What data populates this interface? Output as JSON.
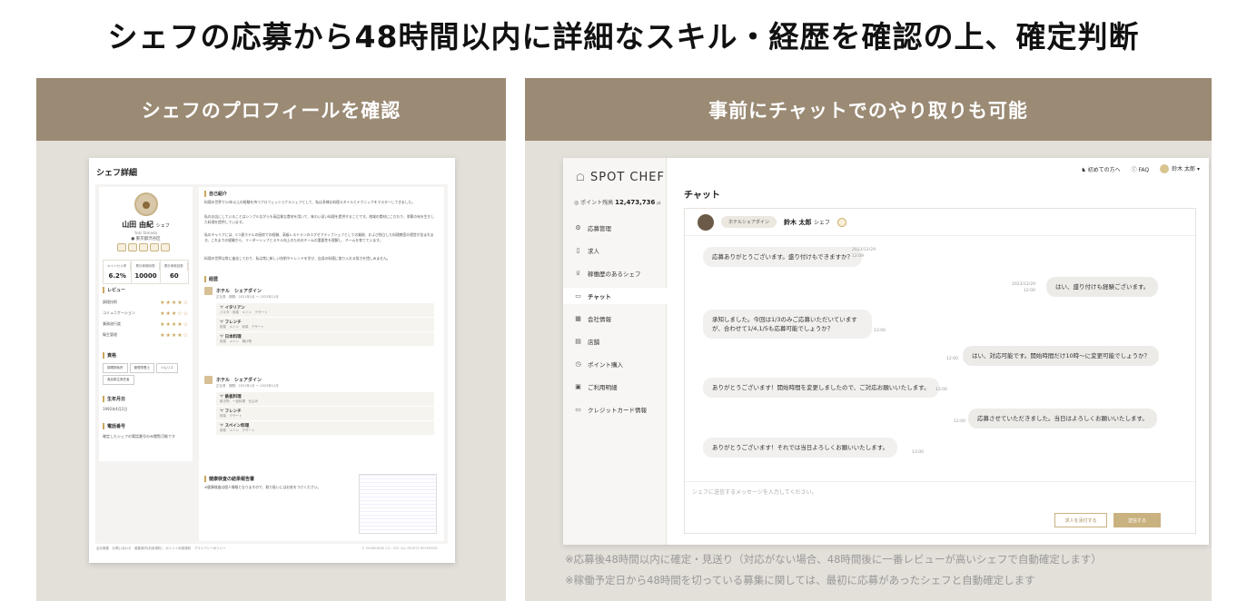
{
  "headline": "シェフの応募から48時間以内に詳細なスキル・経歴を確認の上、確定判断",
  "left_panel": {
    "heading": "シェフのプロフィールを確認",
    "profile": {
      "title": "シェフ詳細",
      "name": "山田 由紀",
      "name_suffix": "シェフ",
      "romaji": "Yuki Yamada",
      "location": "東京都渋谷区",
      "stats": [
        {
          "label": "キャンセル率",
          "value": "6.2%"
        },
        {
          "label": "累計稼働時間",
          "value": "10000"
        },
        {
          "label": "累計稼働回数",
          "value": "60"
        }
      ],
      "review_heading": "レビュー",
      "reviews": [
        {
          "label": "調理技術",
          "stars": "★★★★☆"
        },
        {
          "label": "コミュニケーション",
          "stars": "★★★☆☆"
        },
        {
          "label": "業務遂行度",
          "stars": "★★★★☆"
        },
        {
          "label": "衛生管理",
          "stars": "★★★★☆"
        }
      ],
      "qual_heading": "資格",
      "quals": [
        "調理師免許",
        "管理栄養士",
        "ソムリエ",
        "食品衛生責任者"
      ],
      "birth_heading": "生年月日",
      "birth": "1992年4月2日",
      "phone_heading": "電話番号",
      "phone": "確定したシェフの電話番号のみ閲覧可能です",
      "intro_heading": "自己紹介",
      "intro_1": "料理の世界で10年以上の経験を持つプロフェッショナルシェフとして、私は多様な料理スタイルとテクニックをマスターしてきました。",
      "intro_2": "私のお店にしていることはシンプルながらも高品質な食材を用いて、味わい深い料理を提供することです。地域の食材にこだわり、季節の旬を生かした料理を提供しています。",
      "intro_3": "私のキャリアには、5つ星ホテルの厨房での経験、高級レストランのエグゼクティブシェフとしての業務、および独立した料理教室の運営が含まれます。これまでの経験から、リーダーシップとスキル向上のためのチームの重要性を理解し、チームを育てています。",
      "intro_4": "料理の世界は常に進化しており、私は常に新しい技術やトレンドを学び、自身の料理に取り入れる努力を惜しみません。",
      "career_heading": "経歴",
      "jobs": [
        {
          "place": "ホテル　シェアダイン",
          "period": "正社員　期間：2021年1月 〜 2023年12月",
          "items": [
            {
              "name": "イタリアン",
              "detail": "パスタ・前菜　メイン　デザート"
            },
            {
              "name": "フレンチ",
              "detail": "前菜　メイン　前菜　デザート"
            },
            {
              "name": "日本料理",
              "detail": "前菜　メイン　揚げ物"
            }
          ]
        },
        {
          "place": "ホテル　シェアダイン",
          "period": "正社員　期間：2021年1月 〜 2023年12月",
          "items": [
            {
              "name": "鉄板料理",
              "detail": "焼き物　一品料理　仕込み"
            },
            {
              "name": "フレンチ",
              "detail": "前菜　デザート"
            },
            {
              "name": "スペイン料理",
              "detail": "前菜　メイン　デザート"
            }
          ]
        }
      ],
      "health_heading": "健康検査の結果報告書",
      "health_text": "※健康検査は個人情報となりますので、取り扱いにはお気をつけください。",
      "footer_links": "会社概要　お問い合わせ　募集案内(利用規約)　ポイント利用規約　プライバシーポリシー",
      "footer_copy": "© SHAREDINE CO., LTD. ALL RIGHTS RESERVED."
    }
  },
  "right_panel": {
    "heading": "事前にチャットでのやり取りも可能",
    "app": {
      "logo": "SPOT CHEF",
      "points_label": "ポイント残高",
      "points_value": "12,473,736",
      "points_unit": "pt",
      "nav": [
        {
          "icon": "⚙",
          "label": "応募管理",
          "active": false
        },
        {
          "icon": "▯",
          "label": "求人",
          "active": false
        },
        {
          "icon": "♕",
          "label": "稼働歴のあるシェフ",
          "active": false
        },
        {
          "icon": "▭",
          "label": "チャット",
          "active": true
        },
        {
          "icon": "▦",
          "label": "会社情報",
          "active": false
        },
        {
          "icon": "▤",
          "label": "店舗",
          "active": false
        },
        {
          "icon": "◷",
          "label": "ポイント購入",
          "active": false
        },
        {
          "icon": "▣",
          "label": "ご利用明細",
          "active": false
        },
        {
          "icon": "▭",
          "label": "クレジットカード情報",
          "active": false
        }
      ],
      "topbar": {
        "beginner": "初めての方へ",
        "faq": "FAQ",
        "user": "鈴木 太郎"
      },
      "page_title": "チャット",
      "chat_tag": "ホテルシェアダイン",
      "chat_name": "鈴木 太郎",
      "chat_name_suffix": "シェフ",
      "messages": [
        {
          "side": "l",
          "text": "応募ありがとうございます。盛り付けもできますか？",
          "date": "2023/12/29",
          "time": "12:09"
        },
        {
          "side": "r",
          "text": "はい、盛り付けも経験ございます。",
          "date": "2023/12/29",
          "time": "12:00"
        },
        {
          "side": "l",
          "text": "承知しました。今回は1/3のみご応募いただいていますが、合わせて1/4,1/5も応募可能でしょうか？",
          "date": "",
          "time": "13:00"
        },
        {
          "side": "r",
          "text": "はい、対応可能です。開始時間だけ10時〜に変更可能でしょうか？",
          "date": "",
          "time": "12:00"
        },
        {
          "side": "l",
          "text": "ありがとうございます！開始時間を変更しましたので、ご対応お願いいたします。",
          "date": "",
          "time": "13:00"
        },
        {
          "side": "r",
          "text": "応募させていただきました。当日はよろしくお願いいたします。",
          "date": "",
          "time": "12:00"
        },
        {
          "side": "l",
          "text": "ありがとうございます！それでは当日よろしくお願いいたします。",
          "date": "",
          "time": "13:00"
        }
      ],
      "input_placeholder": "シェフに送信するメッセージを入力してください。",
      "btn_job": "求人を添付する",
      "btn_send": "送信する"
    },
    "notes": [
      "※応募後48時間以内に確定・見送り（対応がない場合、48時間後に一番レビューが高いシェフで自動確定します）",
      "※稼働予定日から48時間を切っている募集に関しては、最初に応募があったシェフと自動確定します"
    ]
  }
}
